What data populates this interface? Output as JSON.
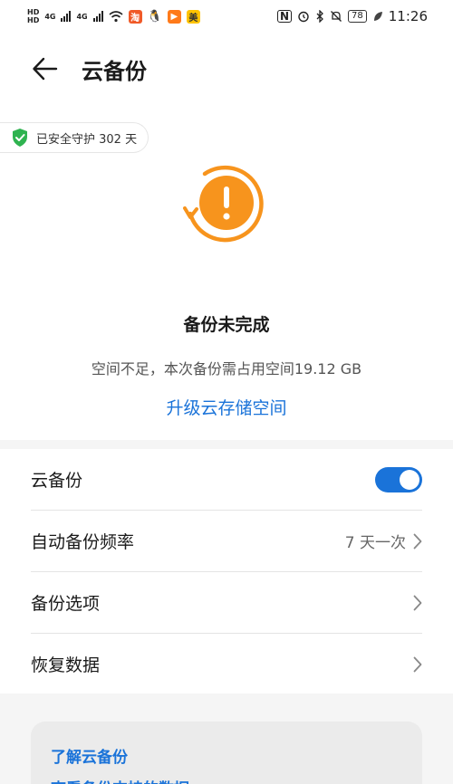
{
  "status_bar": {
    "hd_tag_1": "HD",
    "hd_tag_2": "HD",
    "net_1": "4G",
    "net_2": "4G",
    "app_meituan_label": "美",
    "battery": "78",
    "time": "11:26"
  },
  "header": {
    "title": "云备份"
  },
  "status": {
    "protect_chip": "已安全守护 302 天",
    "title": "备份未完成",
    "description": "空间不足，本次备份需占用空间19.12 GB",
    "upgrade_link": "升级云存储空间"
  },
  "settings": {
    "cloud_backup_label": "云备份",
    "cloud_backup_enabled": true,
    "auto_frequency_label": "自动备份频率",
    "auto_frequency_value": "7 天一次",
    "backup_options_label": "备份选项",
    "restore_label": "恢复数据"
  },
  "learn": {
    "link1": "了解云备份",
    "link2": "查看备份支持的数据"
  },
  "colors": {
    "accent": "#1a73d9",
    "warning": "#f7941d",
    "success": "#2fb350"
  }
}
